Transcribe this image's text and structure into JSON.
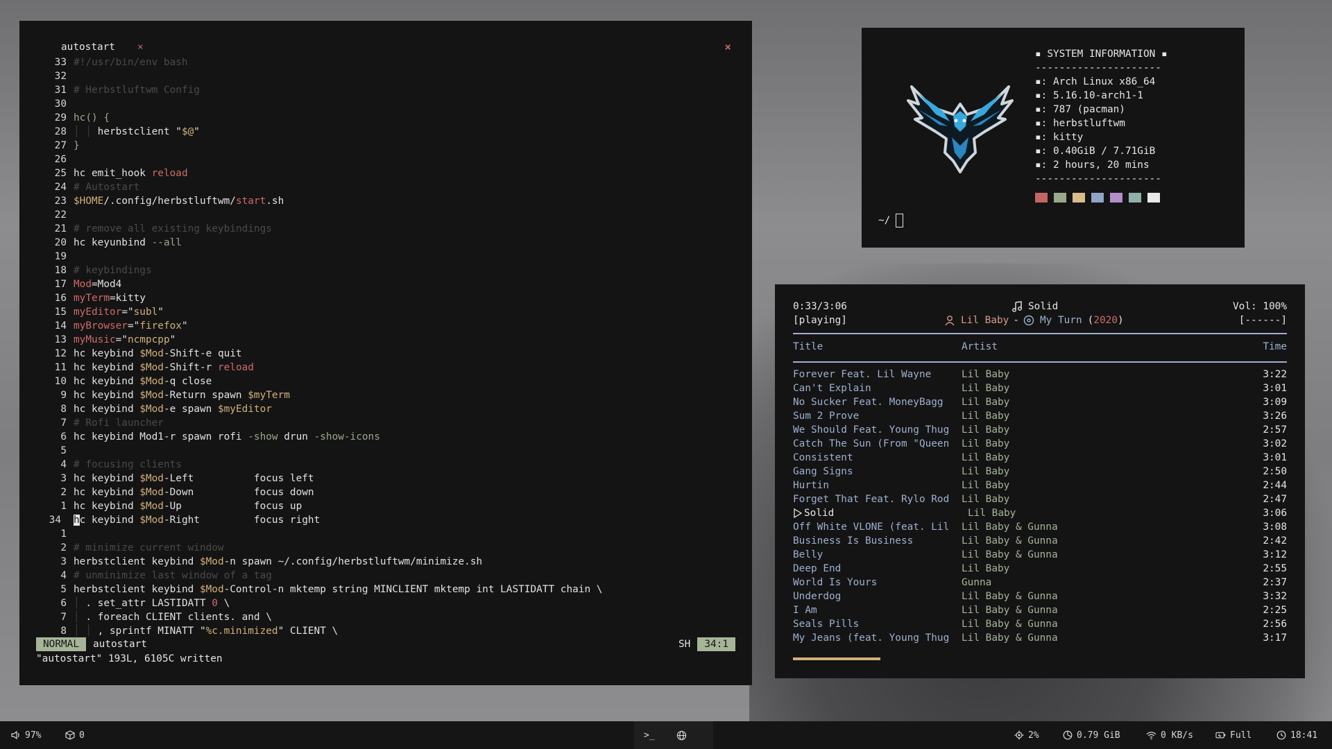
{
  "editor": {
    "tab_name": "autostart",
    "tab_close": "×",
    "window_close": "×",
    "lines": [
      {
        "n": "33",
        "parts": [
          [
            "c",
            "#!/usr/bin/env bash"
          ]
        ]
      },
      {
        "n": "32",
        "parts": []
      },
      {
        "n": "31",
        "parts": [
          [
            "c",
            "# Herbstluftwm Config"
          ]
        ]
      },
      {
        "n": "30",
        "parts": []
      },
      {
        "n": "29",
        "parts": [
          [
            "g",
            "hc() {"
          ]
        ]
      },
      {
        "n": "28",
        "parts": [
          [
            "guide",
            "│ │ "
          ],
          [
            "tx",
            "herbstclient "
          ],
          [
            "tx",
            "\""
          ],
          [
            "y",
            "$@"
          ],
          [
            "tx",
            "\""
          ]
        ]
      },
      {
        "n": "27",
        "parts": [
          [
            "g",
            "}"
          ]
        ]
      },
      {
        "n": "26",
        "parts": []
      },
      {
        "n": "25",
        "parts": [
          [
            "tx",
            "hc emit_hook "
          ],
          [
            "r",
            "reload"
          ]
        ]
      },
      {
        "n": "24",
        "parts": [
          [
            "c",
            "# Autostart"
          ]
        ]
      },
      {
        "n": "23",
        "parts": [
          [
            "y",
            "$HOME"
          ],
          [
            "tx",
            "/.config/herbstluftwm/"
          ],
          [
            "r",
            "start"
          ],
          [
            "tx",
            ".sh"
          ]
        ]
      },
      {
        "n": "22",
        "parts": []
      },
      {
        "n": "21",
        "parts": [
          [
            "c",
            "# remove all existing keybindings"
          ]
        ]
      },
      {
        "n": "20",
        "parts": [
          [
            "tx",
            "hc keyunbind "
          ],
          [
            "g",
            "--all"
          ]
        ]
      },
      {
        "n": "19",
        "parts": []
      },
      {
        "n": "18",
        "parts": [
          [
            "c",
            "# keybindings"
          ]
        ]
      },
      {
        "n": "17",
        "parts": [
          [
            "r",
            "Mod"
          ],
          [
            "tx",
            "=Mod4"
          ]
        ]
      },
      {
        "n": "16",
        "parts": [
          [
            "r",
            "myTerm"
          ],
          [
            "tx",
            "=kitty"
          ]
        ]
      },
      {
        "n": "15",
        "parts": [
          [
            "r",
            "myEditor"
          ],
          [
            "tx",
            "=\""
          ],
          [
            "y",
            "subl"
          ],
          [
            "tx",
            "\""
          ]
        ]
      },
      {
        "n": "14",
        "parts": [
          [
            "r",
            "myBrowser"
          ],
          [
            "tx",
            "=\""
          ],
          [
            "y",
            "firefox"
          ],
          [
            "tx",
            "\""
          ]
        ]
      },
      {
        "n": "13",
        "parts": [
          [
            "r",
            "myMusic"
          ],
          [
            "tx",
            "=\""
          ],
          [
            "y",
            "ncmpcpp"
          ],
          [
            "tx",
            "\""
          ]
        ]
      },
      {
        "n": "12",
        "parts": [
          [
            "tx",
            "hc keybind "
          ],
          [
            "y",
            "$Mod"
          ],
          [
            "tx",
            "-Shift-e quit"
          ]
        ]
      },
      {
        "n": "11",
        "parts": [
          [
            "tx",
            "hc keybind "
          ],
          [
            "y",
            "$Mod"
          ],
          [
            "tx",
            "-Shift-r "
          ],
          [
            "r",
            "reload"
          ]
        ]
      },
      {
        "n": "10",
        "parts": [
          [
            "tx",
            "hc keybind "
          ],
          [
            "y",
            "$Mod"
          ],
          [
            "tx",
            "-q close"
          ]
        ]
      },
      {
        "n": "9",
        "parts": [
          [
            "tx",
            "hc keybind "
          ],
          [
            "y",
            "$Mod"
          ],
          [
            "tx",
            "-Return spawn "
          ],
          [
            "y",
            "$myTerm"
          ]
        ]
      },
      {
        "n": "8",
        "parts": [
          [
            "tx",
            "hc keybind "
          ],
          [
            "y",
            "$Mod"
          ],
          [
            "tx",
            "-e spawn "
          ],
          [
            "y",
            "$myEditor"
          ]
        ]
      },
      {
        "n": "7",
        "parts": [
          [
            "c",
            "# Rofi launcher"
          ]
        ]
      },
      {
        "n": "6",
        "parts": [
          [
            "tx",
            "hc keybind Mod1-r spawn rofi "
          ],
          [
            "g",
            "-show"
          ],
          [
            "tx",
            " drun "
          ],
          [
            "g",
            "-show-icons"
          ]
        ]
      },
      {
        "n": "5",
        "parts": []
      },
      {
        "n": "4",
        "parts": [
          [
            "c",
            "# focusing clients"
          ]
        ]
      },
      {
        "n": "3",
        "parts": [
          [
            "tx",
            "hc keybind "
          ],
          [
            "y",
            "$Mod"
          ],
          [
            "tx",
            "-Left          focus left"
          ]
        ]
      },
      {
        "n": "2",
        "parts": [
          [
            "tx",
            "hc keybind "
          ],
          [
            "y",
            "$Mod"
          ],
          [
            "tx",
            "-Down          focus down"
          ]
        ]
      },
      {
        "n": "1",
        "parts": [
          [
            "tx",
            "hc keybind "
          ],
          [
            "y",
            "$Mod"
          ],
          [
            "tx",
            "-Up            focus up"
          ]
        ]
      },
      {
        "n": "34",
        "cur": true,
        "parts": [
          [
            "cursor",
            "h"
          ],
          [
            "tx",
            "c keybind "
          ],
          [
            "y",
            "$Mod"
          ],
          [
            "tx",
            "-Right         focus right"
          ]
        ]
      },
      {
        "n": "1",
        "parts": []
      },
      {
        "n": "2",
        "parts": [
          [
            "c",
            "# minimize current window"
          ]
        ]
      },
      {
        "n": "3",
        "parts": [
          [
            "tx",
            "herbstclient keybind "
          ],
          [
            "y",
            "$Mod"
          ],
          [
            "tx",
            "-n spawn ~/.config/herbstluftwm/minimize.sh"
          ]
        ]
      },
      {
        "n": "4",
        "parts": [
          [
            "c",
            "# unminimize last window of a tag"
          ]
        ]
      },
      {
        "n": "5",
        "parts": [
          [
            "tx",
            "herbstclient keybind "
          ],
          [
            "y",
            "$Mod"
          ],
          [
            "tx",
            "-Control-n mktemp string MINCLIENT mktemp int LASTIDATT chain \\"
          ]
        ]
      },
      {
        "n": "6",
        "parts": [
          [
            "guide",
            "│ "
          ],
          [
            "tx",
            ". set_attr LASTIDATT "
          ],
          [
            "r",
            "0"
          ],
          [
            "tx",
            " \\"
          ]
        ]
      },
      {
        "n": "7",
        "parts": [
          [
            "guide",
            "│ "
          ],
          [
            "tx",
            ". foreach CLIENT clients. and \\"
          ]
        ]
      },
      {
        "n": "8",
        "parts": [
          [
            "guide",
            "│ │ "
          ],
          [
            "tx",
            ", sprintf MINATT \""
          ],
          [
            "y",
            "%c.minimized"
          ],
          [
            "tx",
            "\" CLIENT \\"
          ]
        ]
      }
    ],
    "status": {
      "mode": "NORMAL",
      "filename": "autostart",
      "filetype": "SH",
      "position": "34:1"
    },
    "message": "\"autostart\" 193L, 6105C written"
  },
  "sysinfo": {
    "rows": [
      "▪ SYSTEM INFORMATION ▪",
      "---------------------",
      "▪: Arch Linux x86_64",
      "▪: 5.16.10-arch1-1",
      "▪: 787 (pacman)",
      "▪: herbstluftwm",
      "▪: kitty",
      "▪: 0.40GiB / 7.71GiB",
      "▪: 2 hours, 20 mins",
      "---------------------"
    ],
    "swatches": [
      "#c46464",
      "#9aa88a",
      "#d8bc8a",
      "#8fa4c8",
      "#b48ec8",
      "#8fb0a8",
      "#e8e8e8"
    ],
    "prompt": "~/",
    "logo_icon": "eagle-logo"
  },
  "music": {
    "elapsed": "0:33/3:06",
    "state": "[playing]",
    "song": "Solid",
    "artist": "Lil Baby",
    "dash": "-",
    "album": "My Turn",
    "year_open": "(",
    "year": "2020",
    "year_close": ")",
    "volume": "Vol: 100%",
    "flags": "[------]",
    "headers": {
      "title": "Title",
      "artist": "Artist",
      "time": "Time"
    },
    "tracks": [
      {
        "title": "Forever Feat. Lil Wayne",
        "artist": "Lil Baby",
        "time": "3:22"
      },
      {
        "title": "Can't Explain",
        "artist": "Lil Baby",
        "time": "3:01"
      },
      {
        "title": "No Sucker Feat. MoneyBagg",
        "artist": "Lil Baby",
        "time": "3:09"
      },
      {
        "title": "Sum 2 Prove",
        "artist": "Lil Baby",
        "time": "3:26"
      },
      {
        "title": "We Should Feat. Young Thug",
        "artist": "Lil Baby",
        "time": "2:57"
      },
      {
        "title": "Catch The Sun (From \"Queen",
        "artist": "Lil Baby",
        "time": "3:02"
      },
      {
        "title": "Consistent",
        "artist": "Lil Baby",
        "time": "3:01"
      },
      {
        "title": "Gang Signs",
        "artist": "Lil Baby",
        "time": "2:50"
      },
      {
        "title": "Hurtin",
        "artist": "Lil Baby",
        "time": "2:44"
      },
      {
        "title": "Forget That Feat. Rylo Rod",
        "artist": "Lil Baby",
        "time": "2:47"
      },
      {
        "title": "Solid",
        "artist": "Lil Baby",
        "time": "3:06",
        "playing": true
      },
      {
        "title": "Off White VLONE (feat. Lil",
        "artist": "Lil Baby & Gunna",
        "time": "3:08"
      },
      {
        "title": "Business Is Business",
        "artist": "Lil Baby & Gunna",
        "time": "2:42"
      },
      {
        "title": "Belly",
        "artist": "Lil Baby & Gunna",
        "time": "3:12"
      },
      {
        "title": "Deep End",
        "artist": "Lil Baby",
        "time": "2:55"
      },
      {
        "title": "World Is Yours",
        "artist": "Gunna",
        "time": "2:37"
      },
      {
        "title": "Underdog",
        "artist": "Lil Baby & Gunna",
        "time": "3:32"
      },
      {
        "title": "I Am",
        "artist": "Lil Baby & Gunna",
        "time": "2:25"
      },
      {
        "title": "Seals Pills",
        "artist": "Lil Baby & Gunna",
        "time": "2:56"
      },
      {
        "title": "My Jeans (feat. Young Thug",
        "artist": "Lil Baby & Gunna",
        "time": "3:17"
      }
    ],
    "progress_fraction": 0.177
  },
  "bar": {
    "volume": "97%",
    "updates": "0",
    "terminal_symbol": ">_",
    "cpu": "2%",
    "memory": "0.79 GiB",
    "network": "0 KB/s",
    "battery": "Full",
    "clock": "18:41"
  }
}
